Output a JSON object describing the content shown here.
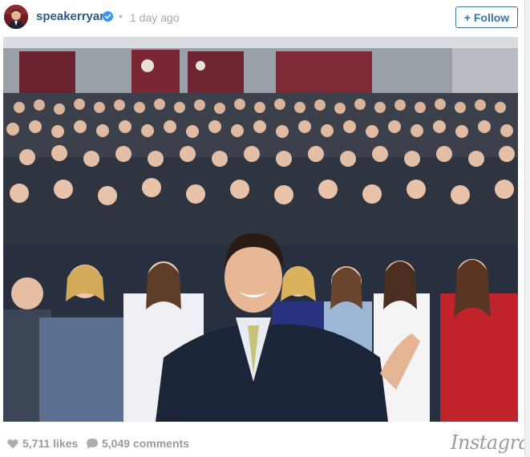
{
  "header": {
    "username": "speakerryan",
    "separator": "•",
    "timestamp": "1 day ago",
    "follow_label": "+ Follow",
    "avatar_icon": "profile-avatar",
    "verified_icon": "verified-badge-icon"
  },
  "photo": {
    "icon": "group-selfie-photo"
  },
  "footer": {
    "likes": "5,711 likes",
    "comments": "5,049 comments",
    "brand": "Instagram"
  },
  "colors": {
    "username": "#2b5a83",
    "follow_border": "#3f729b",
    "meta_text": "#9a9a9a",
    "verified": "#3897f0"
  }
}
